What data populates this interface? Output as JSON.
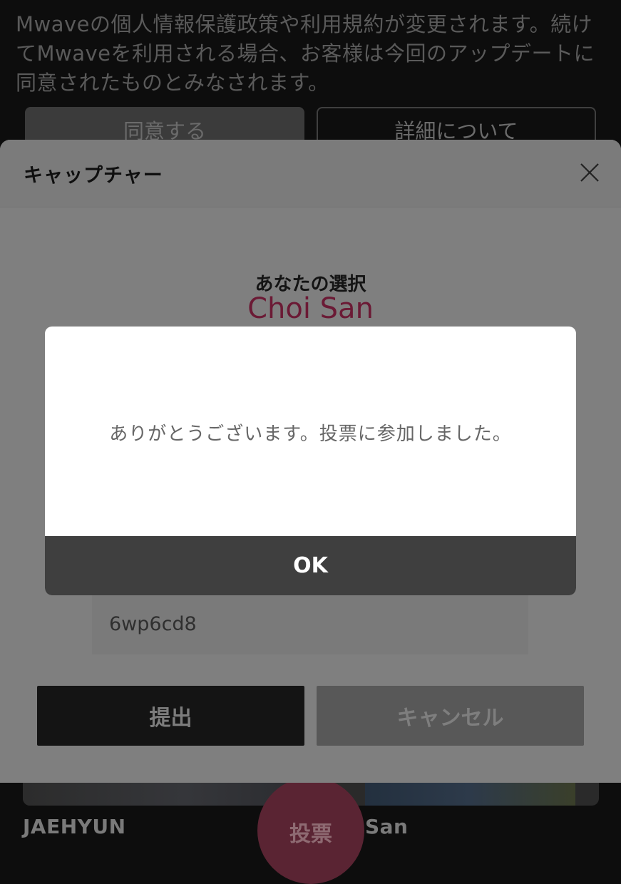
{
  "notice": {
    "text": "Mwaveの個人情報保護政策や利用規約が変更されます。続けてMwaveを利用される場合、お客様は今回のアップデートに同意されたものとみなされます。",
    "agree_label": "同意する",
    "detail_label": "詳細について"
  },
  "cards": {
    "left_name": "JAEHYUN",
    "right_name": "San",
    "vote_label": "投票"
  },
  "captcha_sheet": {
    "title": "キャップチャー",
    "close_icon": "close-icon",
    "choice_label": "あなたの選択",
    "choice_name": "Choi San",
    "captcha_value": "6wp6cd8",
    "submit_label": "提出",
    "cancel_label": "キャンセル"
  },
  "dialog": {
    "message": "ありがとうございます。投票に参加しました。",
    "ok_label": "OK"
  },
  "colors": {
    "accent": "#b0245a",
    "overlay": "#0d0d0d",
    "dialog_button": "#3f3f3f"
  }
}
